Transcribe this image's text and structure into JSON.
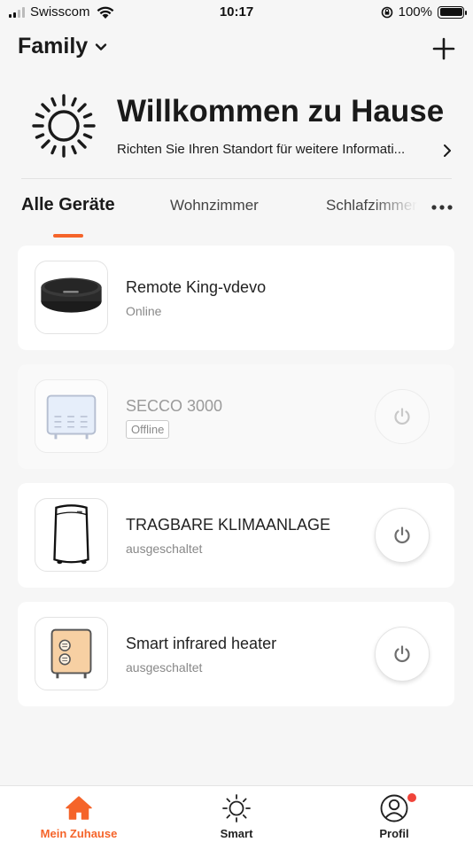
{
  "status_bar": {
    "carrier": "Swisscom",
    "time": "10:17",
    "battery": "100%"
  },
  "header": {
    "home_name": "Family",
    "add_icon": "plus-icon"
  },
  "welcome": {
    "title": "Willkommen zu Hause",
    "subtitle": "Richten Sie Ihren Standort für weitere Informati...",
    "icon": "sun-icon"
  },
  "tabs": [
    {
      "label": "Alle Geräte",
      "active": true
    },
    {
      "label": "Wohnzimmer",
      "active": false
    },
    {
      "label": "Schlafzimmer",
      "active": false
    }
  ],
  "devices": [
    {
      "name": "Remote King-vdevo",
      "status": "Online",
      "icon": "ir-remote-hub-icon",
      "has_power": false
    },
    {
      "name": "SECCO 3000",
      "status": "Offline",
      "icon": "panel-heater-icon",
      "has_power": true,
      "offline": true
    },
    {
      "name": "TRAGBARE KLIMAANLAGE",
      "status": "ausgeschaltet",
      "icon": "portable-air-conditioner-icon",
      "has_power": true
    },
    {
      "name": "Smart infrared heater",
      "status": "ausgeschaltet",
      "icon": "infrared-heater-icon",
      "has_power": true
    }
  ],
  "tab_bar": [
    {
      "label": "Mein Zuhause",
      "icon": "home-icon",
      "active": true
    },
    {
      "label": "Smart",
      "icon": "smart-sun-icon",
      "active": false
    },
    {
      "label": "Profil",
      "icon": "profile-icon",
      "active": false,
      "badge": true
    }
  ],
  "colors": {
    "accent": "#f5642a",
    "badge": "#f0443a",
    "background": "#f6f6f6"
  }
}
